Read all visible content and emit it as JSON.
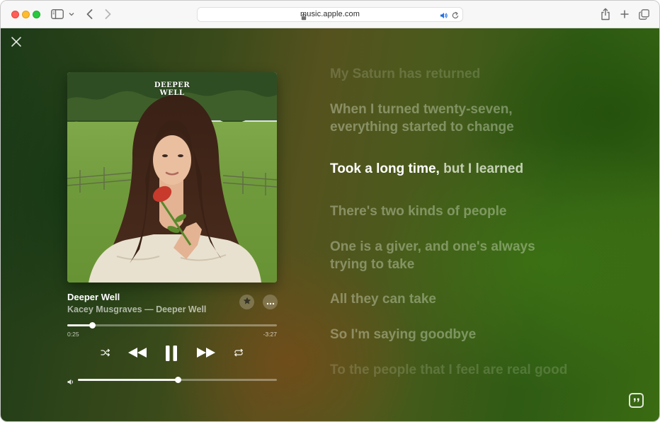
{
  "browser": {
    "url": "music.apple.com",
    "icons": [
      "sidebar-icon",
      "chevron-down-icon",
      "back-icon",
      "forward-icon",
      "lock-icon",
      "speaker-icon",
      "reload-icon",
      "share-icon",
      "plus-icon",
      "tabs-overview-icon"
    ]
  },
  "album_art": {
    "logo_line1": "DEEPER",
    "logo_line2": "WELL"
  },
  "track": {
    "title": "Deeper Well",
    "artist": "Kacey Musgraves",
    "separator": " — ",
    "album": "Deeper Well",
    "elapsed": "0:25",
    "remaining": "-3:27",
    "progress_fraction": 0.118,
    "volume_fraction": 0.5
  },
  "lyrics": {
    "lines": [
      "My Saturn has returned",
      "When I turned twenty-seven,",
      "everything started to change",
      "There's two kinds of people",
      "One is a giver, and one's always",
      "trying to take",
      "All they can take",
      "So I'm saying goodbye",
      "To the people that I feel are real good"
    ],
    "active_sung": "Took a long time,",
    "active_rest": "but I learned"
  },
  "colors": {
    "accent": "#ffffff",
    "background_green": "#2f5b14",
    "background_brown": "#784b19"
  }
}
